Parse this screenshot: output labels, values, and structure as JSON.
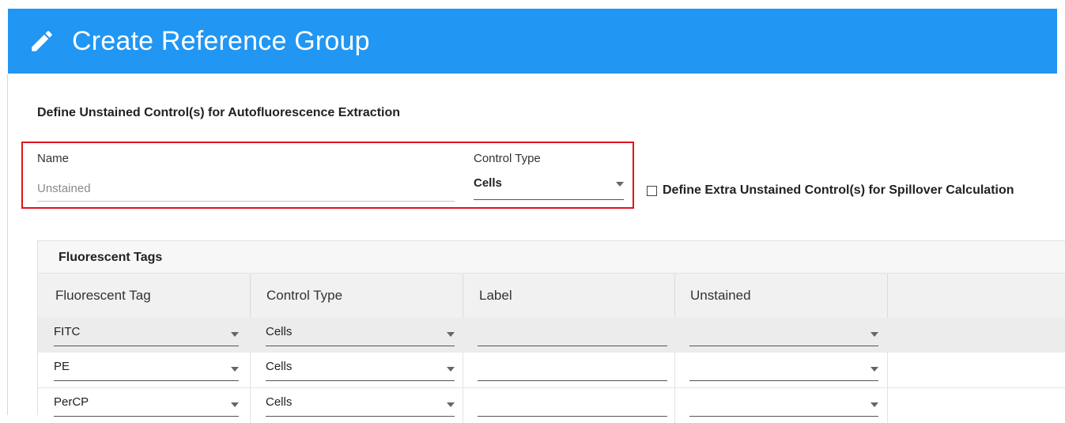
{
  "header": {
    "title": "Create Reference Group",
    "icon": "pencil-icon",
    "background_color": "#2196f3"
  },
  "section": {
    "title": "Define Unstained Control(s) for Autofluorescence Extraction"
  },
  "unstained_control": {
    "name_label": "Name",
    "name_placeholder": "Unstained",
    "name_value": "",
    "control_type_label": "Control Type",
    "control_type_value": "Cells",
    "highlight_color": "#e0141e"
  },
  "extra_unstained": {
    "checkbox_symbol": "☐",
    "label": "Define Extra Unstained Control(s) for Spillover Calculation",
    "checked": false
  },
  "fluorescent_tags_table": {
    "caption": "Fluorescent Tags",
    "columns": [
      "Fluorescent Tag",
      "Control Type",
      "Label",
      "Unstained"
    ],
    "rows": [
      {
        "tag": "FITC",
        "control_type": "Cells",
        "label": "",
        "unstained": ""
      },
      {
        "tag": "PE",
        "control_type": "Cells",
        "label": "",
        "unstained": ""
      },
      {
        "tag": "PerCP",
        "control_type": "Cells",
        "label": "",
        "unstained": ""
      }
    ]
  }
}
